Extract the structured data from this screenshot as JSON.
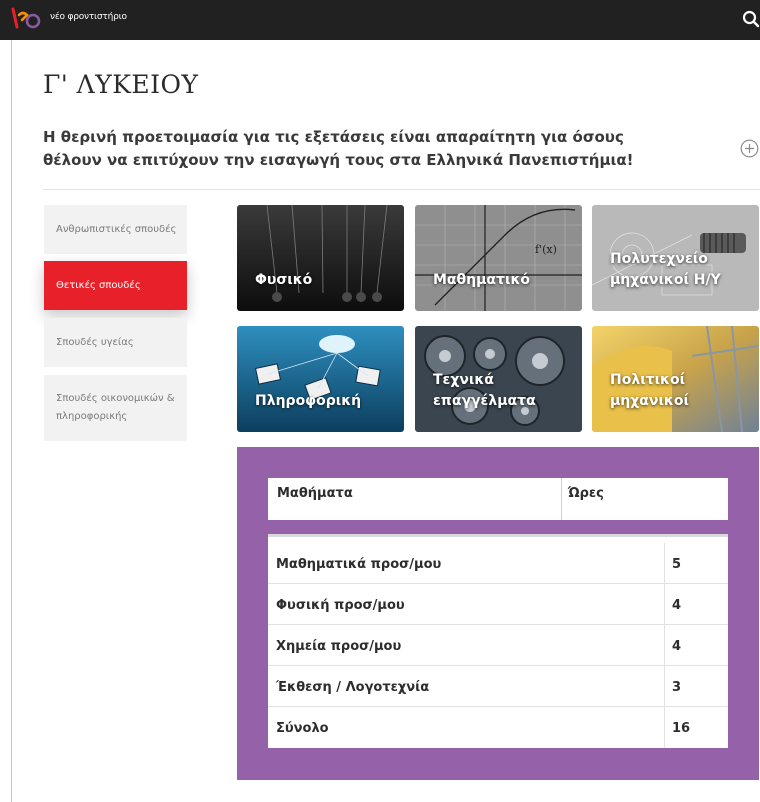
{
  "header": {
    "brand": "νέο φροντιστήριο",
    "logo_icon": "neo-logo-icon",
    "search_icon": "search-icon"
  },
  "page": {
    "title": "Γ' ΛΥΚΕΙΟΥ",
    "intro": "Η θερινή προετοιμασία για τις εξετάσεις είναι απαραίτητη για όσους θέλουν να επιτύχουν την εισαγωγή τους στα Ελληνικά Πανεπιστήμια!",
    "expand_icon": "plus-circle-icon"
  },
  "categories": [
    {
      "label": "Ανθρωπιστικές σπουδές",
      "active": false
    },
    {
      "label": "Θετικές σπουδές",
      "active": true
    },
    {
      "label": "Σπουδές υγείας",
      "active": false
    },
    {
      "label": "Σπουδές οικονομικών & πληροφορικής",
      "active": false
    }
  ],
  "tiles": [
    {
      "label": "Φυσικό"
    },
    {
      "label": "Μαθηματικό"
    },
    {
      "label": "Πολυτεχνείο μηχανικοί Η/Υ"
    },
    {
      "label": "Πληροφορική"
    },
    {
      "label": "Τεχνικά επαγγέλματα"
    },
    {
      "label": "Πολιτικοί μηχανικοί"
    }
  ],
  "table": {
    "headers": [
      "Μαθήματα",
      "Ώρες"
    ],
    "rows": [
      {
        "subject": "Μαθηματικά προσ/μου",
        "hours": "5"
      },
      {
        "subject": "Φυσική προσ/μου",
        "hours": "4"
      },
      {
        "subject": "Χημεία προσ/μου",
        "hours": "4"
      },
      {
        "subject": "Έκθεση / Λογοτεχνία",
        "hours": "3"
      },
      {
        "subject": "Σύνολο",
        "hours": "16"
      }
    ]
  },
  "colors": {
    "header_bg": "#212121",
    "accent_red": "#e8202a",
    "panel_purple": "#9561a8"
  }
}
